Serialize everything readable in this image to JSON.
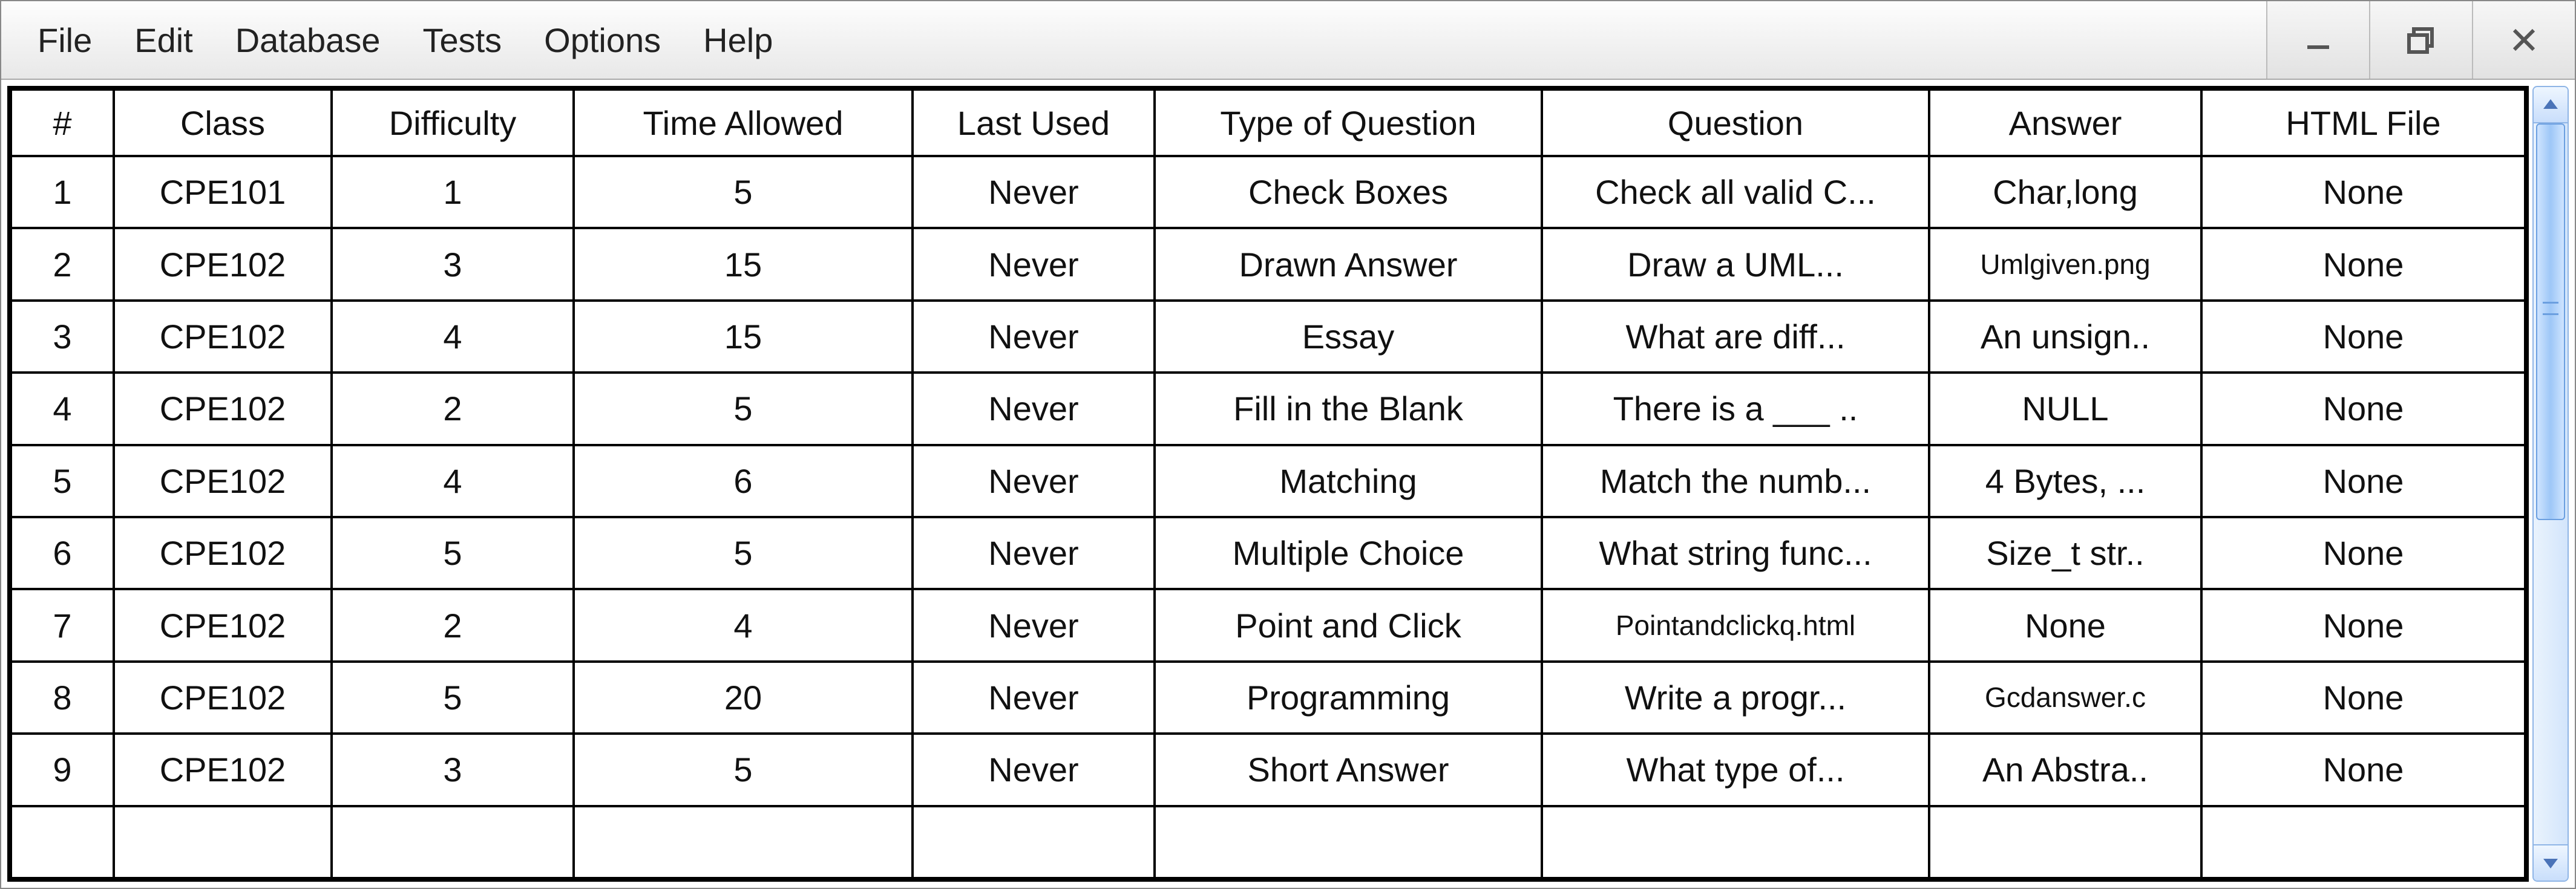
{
  "menu": {
    "file": "File",
    "edit": "Edit",
    "database": "Database",
    "tests": "Tests",
    "options": "Options",
    "help": "Help"
  },
  "columns": {
    "num": "#",
    "class": "Class",
    "difficulty": "Difficulty",
    "time": "Time Allowed",
    "last": "Last Used",
    "type": "Type of Question",
    "question": "Question",
    "answer": "Answer",
    "html": "HTML File"
  },
  "rows": [
    {
      "num": "1",
      "class": "CPE101",
      "difficulty": "1",
      "time": "5",
      "last": "Never",
      "type": "Check Boxes",
      "question": "Check all valid C...",
      "answer": "Char,long",
      "answer_small": false,
      "html": "None",
      "q_small": false
    },
    {
      "num": "2",
      "class": "CPE102",
      "difficulty": "3",
      "time": "15",
      "last": "Never",
      "type": "Drawn Answer",
      "question": "Draw a UML...",
      "answer": "Umlgiven.png",
      "answer_small": true,
      "html": "None",
      "q_small": false
    },
    {
      "num": "3",
      "class": "CPE102",
      "difficulty": "4",
      "time": "15",
      "last": "Never",
      "type": "Essay",
      "question": "What are diff...",
      "answer": "An unsign..",
      "answer_small": false,
      "html": "None",
      "q_small": false
    },
    {
      "num": "4",
      "class": "CPE102",
      "difficulty": "2",
      "time": "5",
      "last": "Never",
      "type": "Fill in the Blank",
      "question": "There is a ___ ..",
      "answer": "NULL",
      "answer_small": false,
      "html": "None",
      "q_small": false
    },
    {
      "num": "5",
      "class": "CPE102",
      "difficulty": "4",
      "time": "6",
      "last": "Never",
      "type": "Matching",
      "question": "Match the numb...",
      "answer": "4 Bytes, ...",
      "answer_small": false,
      "html": "None",
      "q_small": false
    },
    {
      "num": "6",
      "class": "CPE102",
      "difficulty": "5",
      "time": "5",
      "last": "Never",
      "type": "Multiple Choice",
      "question": "What string func...",
      "answer": "Size_t str..",
      "answer_small": false,
      "html": "None",
      "q_small": false
    },
    {
      "num": "7",
      "class": "CPE102",
      "difficulty": "2",
      "time": "4",
      "last": "Never",
      "type": "Point and Click",
      "question": "Pointandclickq.html",
      "answer": "None",
      "answer_small": false,
      "html": "None",
      "q_small": true
    },
    {
      "num": "8",
      "class": "CPE102",
      "difficulty": "5",
      "time": "20",
      "last": "Never",
      "type": "Programming",
      "question": "Write a progr...",
      "answer": "Gcdanswer.c",
      "answer_small": true,
      "html": "None",
      "q_small": false
    },
    {
      "num": "9",
      "class": "CPE102",
      "difficulty": "3",
      "time": "5",
      "last": "Never",
      "type": "Short Answer",
      "question": "What type of...",
      "answer": "An Abstra..",
      "answer_small": false,
      "html": "None",
      "q_small": false
    },
    {
      "num": "",
      "class": "",
      "difficulty": "",
      "time": "",
      "last": "",
      "type": "",
      "question": "",
      "answer": "",
      "answer_small": false,
      "html": "",
      "q_small": false
    }
  ]
}
